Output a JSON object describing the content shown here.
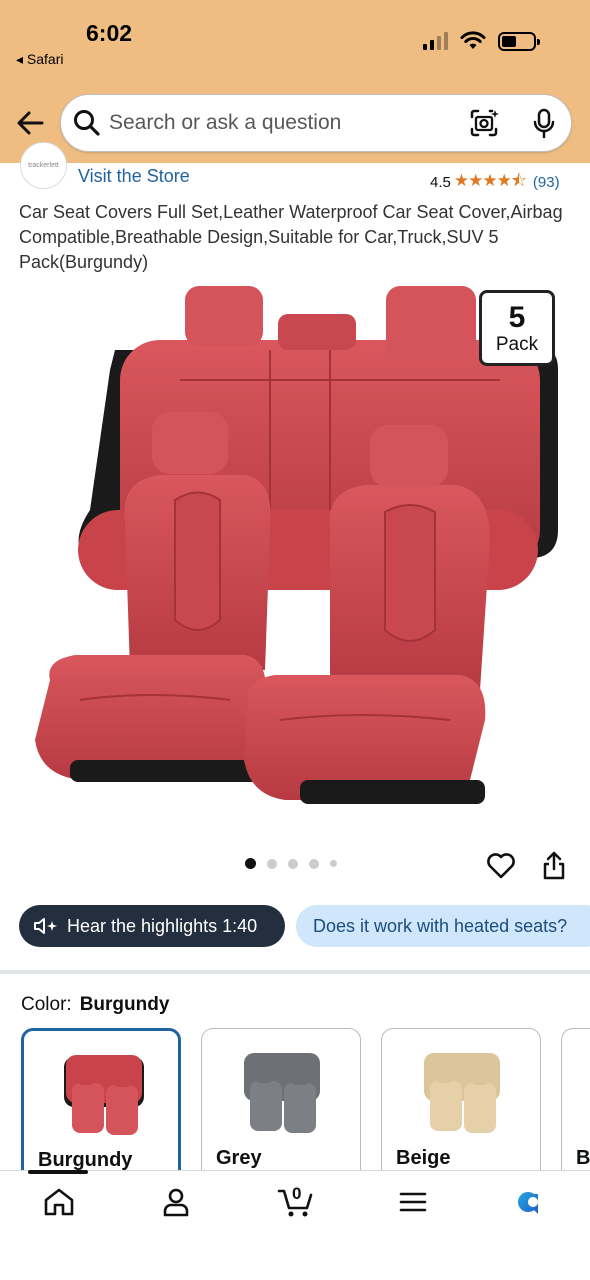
{
  "status_bar": {
    "time": "6:02",
    "back_app": "◂ Safari"
  },
  "search": {
    "placeholder": "Search or ask a question"
  },
  "store": {
    "logo_text": "trackerlett",
    "link": "Visit the Store"
  },
  "rating": {
    "value": "4.5",
    "stars": "★★★★⯪",
    "count": "(93)"
  },
  "product": {
    "title": "Car Seat Covers Full Set,Leather Waterproof Car Seat Cover,Airbag Compatible,Breathable Design,Suitable for Car,Truck,SUV 5 Pack(Burgundy)",
    "badge_number": "5",
    "badge_label": "Pack",
    "image_count": 5,
    "active_image": 1
  },
  "chips": {
    "hear": "Hear the highlights 1:40",
    "ask": "Does it work with heated seats?"
  },
  "color": {
    "label": "Color:",
    "selected": "Burgundy",
    "options": [
      {
        "name": "Burgundy",
        "color": "#c8444a"
      },
      {
        "name": "Grey",
        "color": "#6d7075"
      },
      {
        "name": "Beige",
        "color": "#dcc49b"
      },
      {
        "name": "B",
        "color": "#222222"
      }
    ]
  },
  "nav": {
    "items": [
      "home-icon",
      "account-icon",
      "cart-icon",
      "menu-icon",
      "rufus-icon"
    ],
    "cart_count": "0"
  },
  "colors": {
    "header": "#efbd82",
    "link": "#2162a1",
    "star": "#de7921",
    "seat": "#c8444a"
  }
}
